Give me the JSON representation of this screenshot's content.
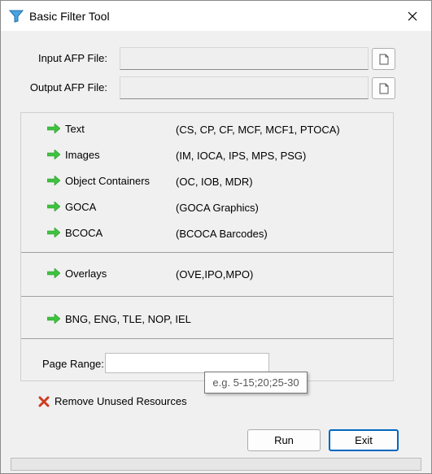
{
  "window": {
    "title": "Basic Filter Tool"
  },
  "files": {
    "input_label": "Input AFP File:",
    "input_value": "",
    "output_label": "Output AFP File:",
    "output_value": ""
  },
  "options": [
    {
      "label": "Text",
      "desc": "(CS, CP, CF, MCF, MCF1, PTOCA)"
    },
    {
      "label": "Images",
      "desc": "(IM, IOCA, IPS, MPS, PSG)"
    },
    {
      "label": "Object Containers",
      "desc": "(OC, IOB, MDR)"
    },
    {
      "label": "GOCA",
      "desc": "(GOCA Graphics)"
    },
    {
      "label": "BCOCA",
      "desc": "(BCOCA Barcodes)"
    }
  ],
  "overlays": {
    "label": "Overlays",
    "desc": "(OVE,IPO,MPO)"
  },
  "misc": {
    "label": "BNG, ENG, TLE, NOP, IEL"
  },
  "page_range": {
    "label": "Page Range:",
    "value": "",
    "tooltip": "e.g. 5-15;20;25-30"
  },
  "remove_unused": {
    "label": "Remove Unused Resources",
    "checked": false
  },
  "buttons": {
    "run": "Run",
    "exit": "Exit"
  },
  "progress": {
    "fraction": 0
  },
  "colors": {
    "arrow": "#3fc23f",
    "x_mark": "#d13a1f",
    "accent": "#0067c0"
  }
}
